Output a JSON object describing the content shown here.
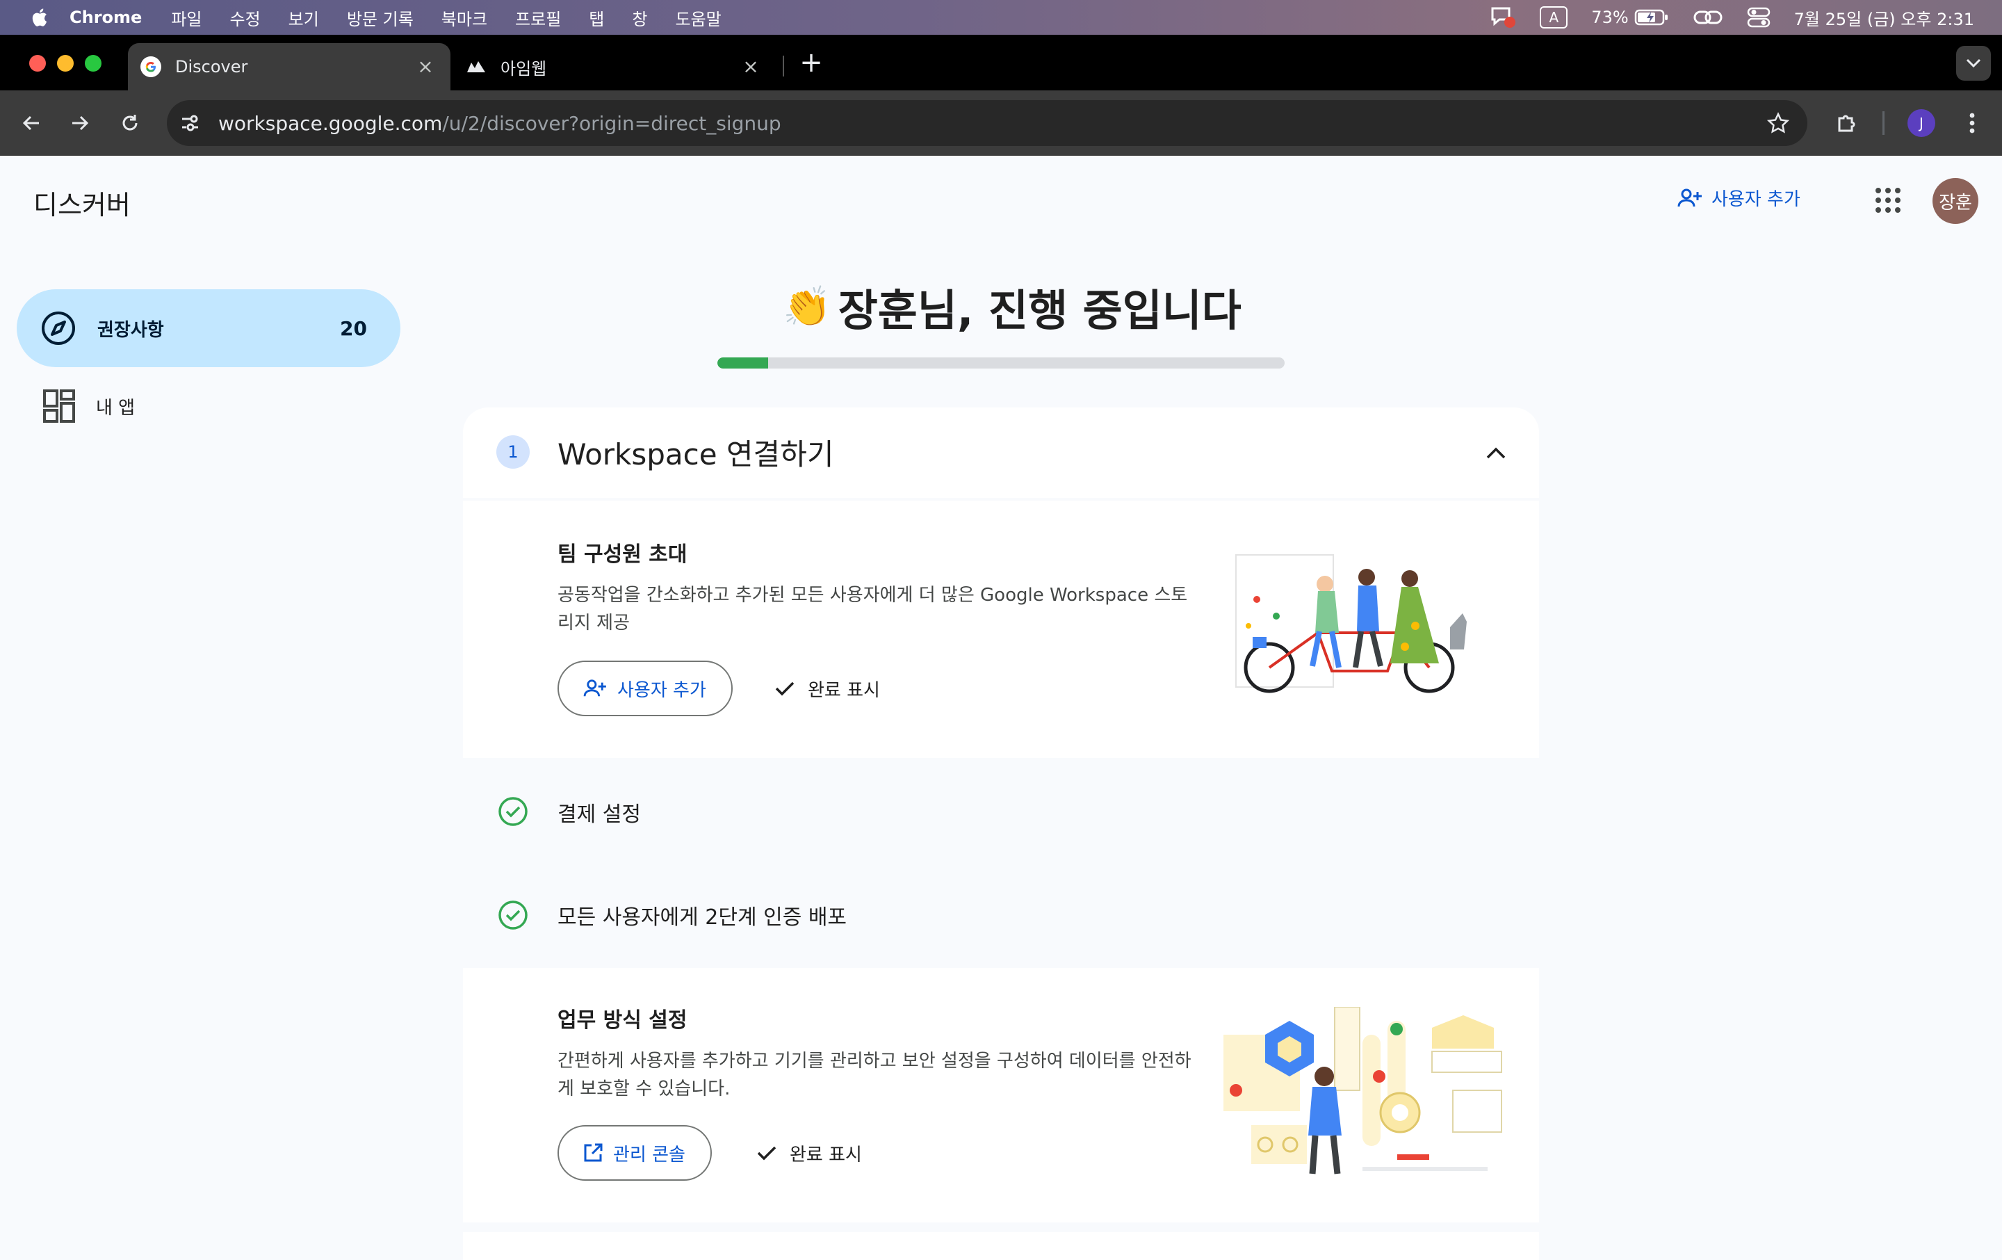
{
  "menubar": {
    "app": "Chrome",
    "items": [
      "파일",
      "수정",
      "보기",
      "방문 기록",
      "북마크",
      "프로필",
      "탭",
      "창",
      "도움말"
    ],
    "input_indicator": "A",
    "battery": "73%",
    "clock": "7월 25일 (금) 오후 2:31"
  },
  "tabs": [
    {
      "title": "Discover",
      "active": true,
      "icon": "google-g-icon"
    },
    {
      "title": "아임웹",
      "active": false,
      "icon": "imweb-icon"
    }
  ],
  "toolbar": {
    "url_host": "workspace.google.com",
    "url_path": "/u/2/discover?origin=direct_signup"
  },
  "header": {
    "title": "디스커버",
    "add_user": "사용자 추가",
    "avatar_initials": "장훈"
  },
  "sidebar": {
    "items": [
      {
        "label": "권장사항",
        "count": "20",
        "icon": "compass-icon",
        "selected": true
      },
      {
        "label": "내 앱",
        "icon": "dashboard-icon",
        "selected": false
      }
    ]
  },
  "main": {
    "greeting_emoji": "👏",
    "greeting": "장훈님, 진행 중입니다",
    "progress": 0.09,
    "card": {
      "step": "1",
      "title": "Workspace 연결하기",
      "sections": [
        {
          "title": "팀 구성원 초대",
          "desc": "공동작업을 간소화하고 추가된 모든 사용자에게 더 많은 Google Workspace 스토리지 제공",
          "button": "사용자 추가",
          "mark_done": "완료 표시"
        },
        {
          "title": "결제 설정",
          "done": true
        },
        {
          "title": "모든 사용자에게 2단계 인증 배포",
          "done": true
        },
        {
          "title": "업무 방식 설정",
          "desc": "간편하게 사용자를 추가하고 기기를 관리하고 보안 설정을 구성하여 데이터를 안전하게 보호할 수 있습니다.",
          "button": "관리 콘솔",
          "mark_done": "완료 표시"
        }
      ]
    }
  },
  "colors": {
    "accent": "#0b57d0",
    "selected_nav": "#c2e7ff",
    "progress_fill": "#34a853",
    "done_check": "#34a853"
  }
}
